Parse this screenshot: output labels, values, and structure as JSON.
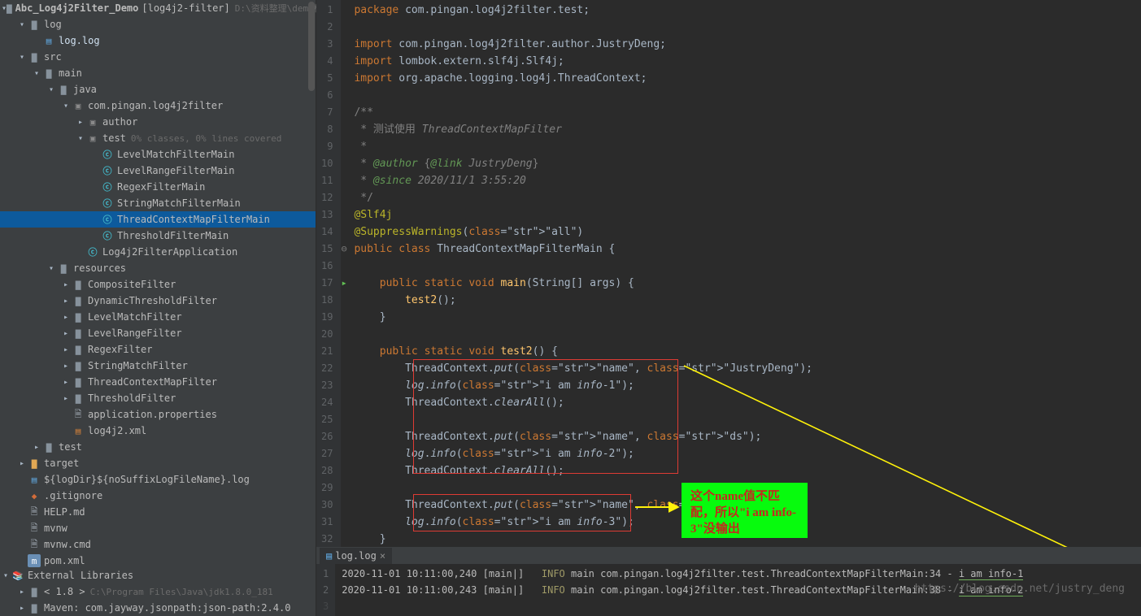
{
  "header": {
    "project": "Abc_Log4j2Filter_Demo",
    "module": "[log4j2-filter]",
    "path": "D:\\资料整理\\demo模板"
  },
  "tree": [
    {
      "ind": 0,
      "chev": "v",
      "icon": "folder",
      "label": "log",
      "cls": ""
    },
    {
      "ind": 1,
      "chev": "",
      "icon": "log",
      "label": "log.log",
      "cls": "open-file"
    },
    {
      "ind": 0,
      "chev": "v",
      "icon": "folder",
      "label": "src",
      "cls": ""
    },
    {
      "ind": 1,
      "chev": "v",
      "icon": "folder",
      "label": "main",
      "cls": ""
    },
    {
      "ind": 2,
      "chev": "v",
      "icon": "folder",
      "label": "java",
      "cls": ""
    },
    {
      "ind": 3,
      "chev": "v",
      "icon": "pkg",
      "label": "com.pingan.log4j2filter",
      "cls": ""
    },
    {
      "ind": 4,
      "chev": ">",
      "icon": "pkg",
      "label": "author",
      "cls": ""
    },
    {
      "ind": 4,
      "chev": "v",
      "icon": "pkg",
      "label": "test",
      "cls": "",
      "dim": "0% classes, 0% lines covered"
    },
    {
      "ind": 5,
      "chev": "",
      "icon": "java",
      "label": "LevelMatchFilterMain",
      "cls": ""
    },
    {
      "ind": 5,
      "chev": "",
      "icon": "java",
      "label": "LevelRangeFilterMain",
      "cls": ""
    },
    {
      "ind": 5,
      "chev": "",
      "icon": "java",
      "label": "RegexFilterMain",
      "cls": ""
    },
    {
      "ind": 5,
      "chev": "",
      "icon": "java",
      "label": "StringMatchFilterMain",
      "cls": ""
    },
    {
      "ind": 5,
      "chev": "",
      "icon": "java",
      "label": "ThreadContextMapFilterMain",
      "cls": "selected"
    },
    {
      "ind": 5,
      "chev": "",
      "icon": "java",
      "label": "ThresholdFilterMain",
      "cls": ""
    },
    {
      "ind": 4,
      "chev": "",
      "icon": "java",
      "label": "Log4j2FilterApplication",
      "cls": ""
    },
    {
      "ind": 2,
      "chev": "v",
      "icon": "folder",
      "label": "resources",
      "cls": ""
    },
    {
      "ind": 3,
      "chev": ">",
      "icon": "folder",
      "label": "CompositeFilter",
      "cls": ""
    },
    {
      "ind": 3,
      "chev": ">",
      "icon": "folder",
      "label": "DynamicThresholdFilter",
      "cls": ""
    },
    {
      "ind": 3,
      "chev": ">",
      "icon": "folder",
      "label": "LevelMatchFilter",
      "cls": ""
    },
    {
      "ind": 3,
      "chev": ">",
      "icon": "folder",
      "label": "LevelRangeFilter",
      "cls": ""
    },
    {
      "ind": 3,
      "chev": ">",
      "icon": "folder",
      "label": "RegexFilter",
      "cls": ""
    },
    {
      "ind": 3,
      "chev": ">",
      "icon": "folder",
      "label": "StringMatchFilter",
      "cls": ""
    },
    {
      "ind": 3,
      "chev": ">",
      "icon": "folder",
      "label": "ThreadContextMapFilter",
      "cls": ""
    },
    {
      "ind": 3,
      "chev": ">",
      "icon": "folder",
      "label": "ThresholdFilter",
      "cls": ""
    },
    {
      "ind": 3,
      "chev": "",
      "icon": "file",
      "label": "application.properties",
      "cls": ""
    },
    {
      "ind": 3,
      "chev": "",
      "icon": "xml",
      "label": "log4j2.xml",
      "cls": ""
    },
    {
      "ind": 1,
      "chev": ">",
      "icon": "folder",
      "label": "test",
      "cls": ""
    },
    {
      "ind": 0,
      "chev": ">",
      "icon": "folder-orange",
      "label": "target",
      "cls": ""
    },
    {
      "ind": 0,
      "chev": "",
      "icon": "log",
      "label": "${logDir}${noSuffixLogFileName}.log",
      "cls": ""
    },
    {
      "ind": 0,
      "chev": "",
      "icon": "git",
      "label": ".gitignore",
      "cls": ""
    },
    {
      "ind": 0,
      "chev": "",
      "icon": "file",
      "label": "HELP.md",
      "cls": ""
    },
    {
      "ind": 0,
      "chev": "",
      "icon": "file",
      "label": "mvnw",
      "cls": ""
    },
    {
      "ind": 0,
      "chev": "",
      "icon": "file",
      "label": "mvnw.cmd",
      "cls": ""
    },
    {
      "ind": 0,
      "chev": "",
      "icon": "m",
      "label": "pom.xml",
      "cls": ""
    }
  ],
  "libs": {
    "ext": "External Libraries",
    "jdk": "< 1.8 >",
    "jdk_path": "C:\\Program Files\\Java\\jdk1.8.0_181",
    "maven": "Maven: com.jayway.jsonpath:json-path:2.4.0"
  },
  "code_lines": [
    "package com.pingan.log4j2filter.test;",
    "",
    "import com.pingan.log4j2filter.author.JustryDeng;",
    "import lombok.extern.slf4j.Slf4j;",
    "import org.apache.logging.log4j.ThreadContext;",
    "",
    "/**",
    " * 测试使用 ThreadContextMapFilter",
    " *",
    " * @author {@link JustryDeng}",
    " * @since 2020/11/1 3:55:20",
    " */",
    "@Slf4j",
    "@SuppressWarnings(\"all\")",
    "public class ThreadContextMapFilterMain {",
    "",
    "    public static void main(String[] args) {",
    "        test2();",
    "    }",
    "",
    "    public static void test2() {",
    "        ThreadContext.put(\"name\", \"JustryDeng\");",
    "        log.info(\"i am info-1\");",
    "        ThreadContext.clearAll();",
    "",
    "        ThreadContext.put(\"name\", \"ds\");",
    "        log.info(\"i am info-2\");",
    "        ThreadContext.clearAll();",
    "",
    "        ThreadContext.put(\"name\", \"abc\");",
    "        log.info(\"i am info-3\");",
    "    }"
  ],
  "annotation": "这个name值不匹配，所以\"i am info-3\"没输出",
  "bottom_tab": "log.log",
  "log_output": [
    {
      "ts": "2020-11-01 10:11:00,240",
      "thread": "[main|]",
      "level": "INFO",
      "rest": "main com.pingan.log4j2filter.test.ThreadContextMapFilterMain:34 - ",
      "msg": "i am info-1"
    },
    {
      "ts": "2020-11-01 10:11:00,243",
      "thread": "[main|]",
      "level": "INFO",
      "rest": "main com.pingan.log4j2filter.test.ThreadContextMapFilterMain:38 - ",
      "msg": "i am info-2"
    }
  ],
  "watermark": "https://blog.csdn.net/justry_deng"
}
